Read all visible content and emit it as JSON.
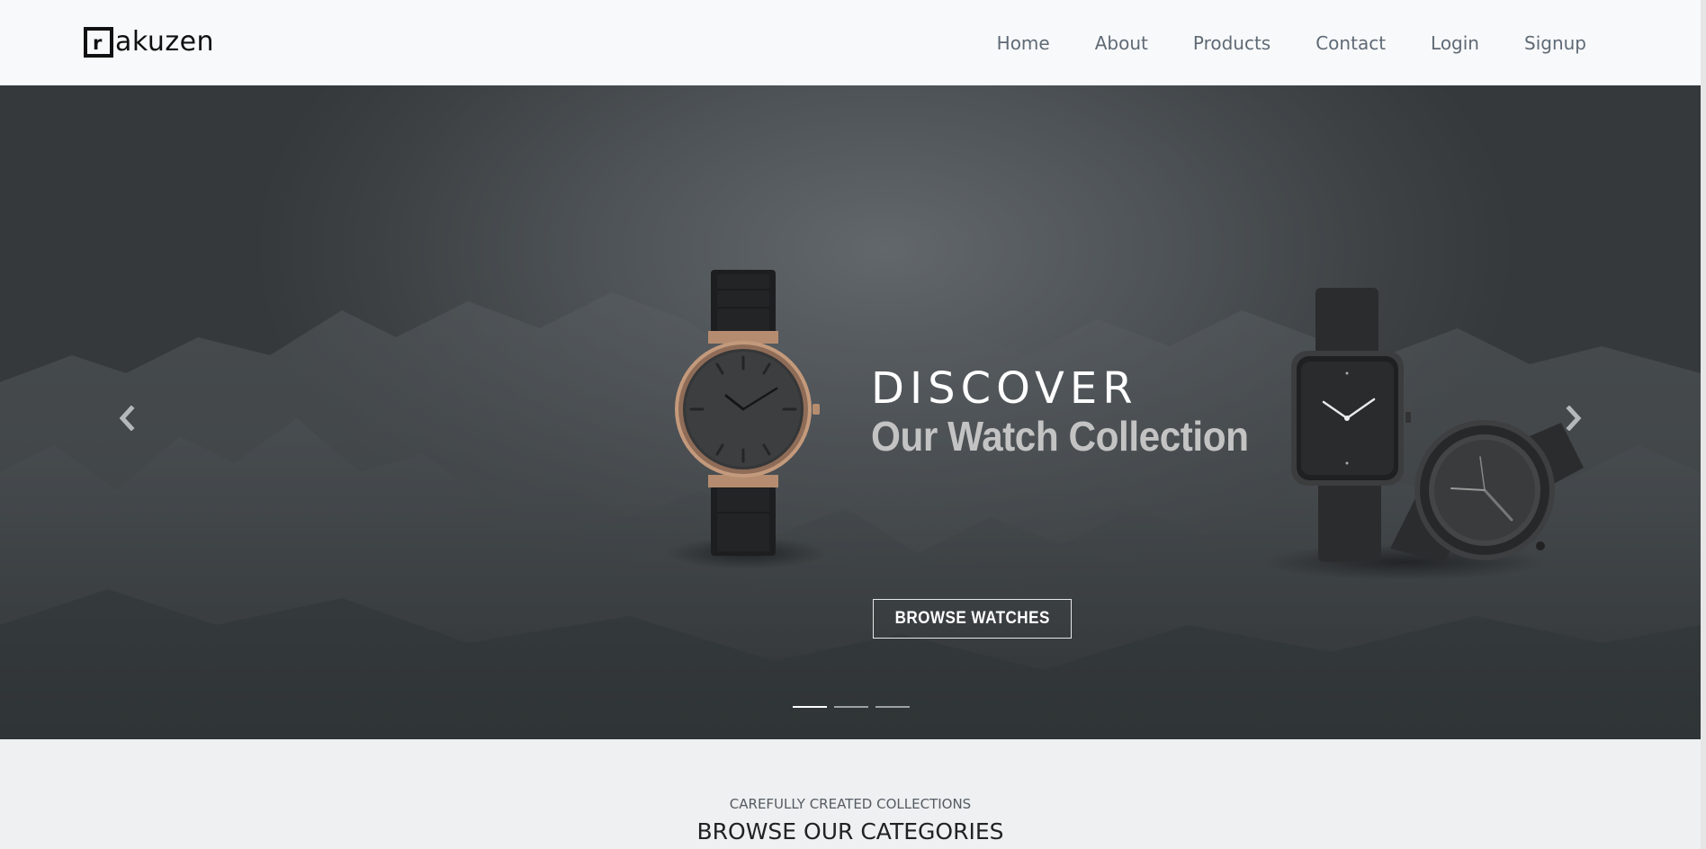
{
  "brand": {
    "logo_letter": "r",
    "name": "akuzen"
  },
  "nav": {
    "items": [
      {
        "label": "Home"
      },
      {
        "label": "About"
      },
      {
        "label": "Products"
      },
      {
        "label": "Contact"
      },
      {
        "label": "Login"
      },
      {
        "label": "Signup"
      }
    ]
  },
  "hero": {
    "heading": "DISCOVER",
    "subheading": "Our Watch Collection",
    "button_label": "BROWSE WATCHES",
    "prev_icon": "chevron-left-icon",
    "next_icon": "chevron-right-icon",
    "slides_count": 3,
    "active_slide": 1
  },
  "categories": {
    "eyebrow": "CAREFULLY CREATED COLLECTIONS",
    "title": "BROWSE OUR CATEGORIES"
  },
  "colors": {
    "navbar_bg": "#f8f9fa",
    "nav_link": "#5f6a75",
    "hero_bg": "#4e5357",
    "page_bg": "#eef0f1"
  }
}
